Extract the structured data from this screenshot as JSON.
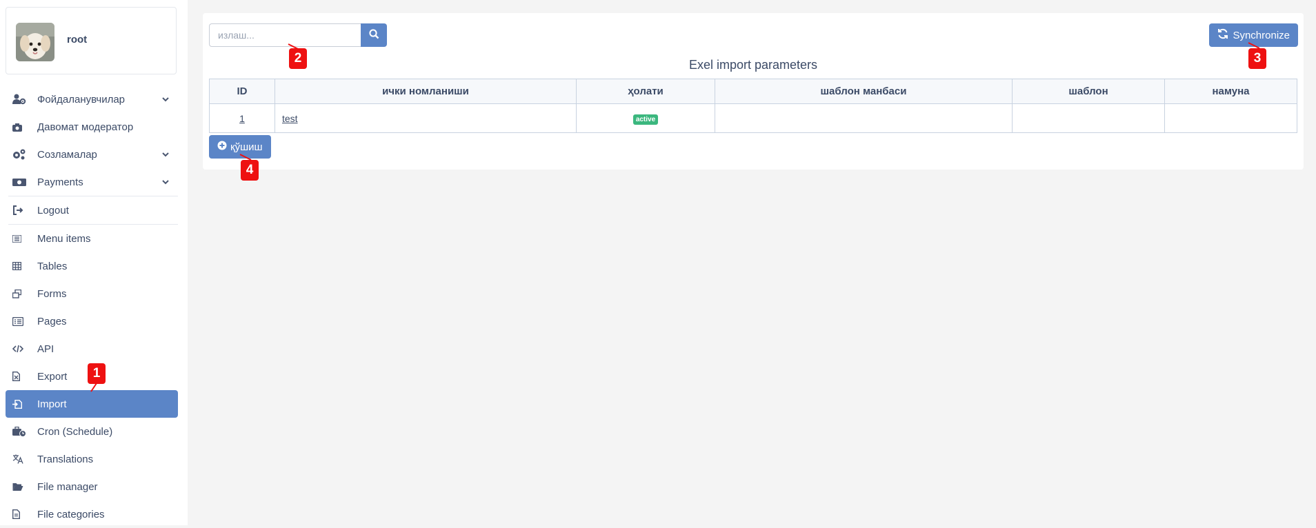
{
  "user": {
    "name": "root"
  },
  "sidebar": {
    "items": [
      {
        "label": "Фойдаланувчилар",
        "icon": "users-cog-icon",
        "has_submenu": true
      },
      {
        "label": "Давомат модератор",
        "icon": "camera-icon",
        "has_submenu": false
      },
      {
        "label": "Созламалар",
        "icon": "gears-icon",
        "has_submenu": true
      },
      {
        "label": "Payments",
        "icon": "money-icon",
        "has_submenu": true
      },
      {
        "label": "Logout",
        "icon": "sign-out-icon",
        "has_submenu": false
      },
      {
        "label": "Menu items",
        "icon": "list-icon",
        "has_submenu": false
      },
      {
        "label": "Tables",
        "icon": "table-icon",
        "has_submenu": false
      },
      {
        "label": "Forms",
        "icon": "windows-icon",
        "has_submenu": false
      },
      {
        "label": "Pages",
        "icon": "list-alt-icon",
        "has_submenu": false
      },
      {
        "label": "API",
        "icon": "code-icon",
        "has_submenu": false
      },
      {
        "label": "Export",
        "icon": "file-excel-icon",
        "has_submenu": false
      },
      {
        "label": "Import",
        "icon": "file-import-icon",
        "has_submenu": false,
        "active": true
      },
      {
        "label": "Cron (Schedule)",
        "icon": "business-time-icon",
        "has_submenu": false
      },
      {
        "label": "Translations",
        "icon": "language-icon",
        "has_submenu": false
      },
      {
        "label": "File manager",
        "icon": "folder-open-icon",
        "has_submenu": false
      },
      {
        "label": "File categories",
        "icon": "file-alt-icon",
        "has_submenu": false
      }
    ]
  },
  "search": {
    "placeholder": "излаш..."
  },
  "toolbar": {
    "sync_label": "Synchronize",
    "add_label": "қўшиш"
  },
  "table": {
    "title": "Exel import parameters",
    "columns": [
      "ID",
      "ички номланиши",
      "ҳолати",
      "шаблон манбаси",
      "шаблон",
      "намуна"
    ],
    "rows": [
      {
        "id": "1",
        "name": "test",
        "status": "active",
        "template_source": "",
        "template": "",
        "sample": ""
      }
    ]
  },
  "markers": [
    "1",
    "2",
    "3",
    "4"
  ],
  "colors": {
    "accent": "#5b85c7",
    "badge": "#3bb77e",
    "marker": "#ee1111"
  }
}
